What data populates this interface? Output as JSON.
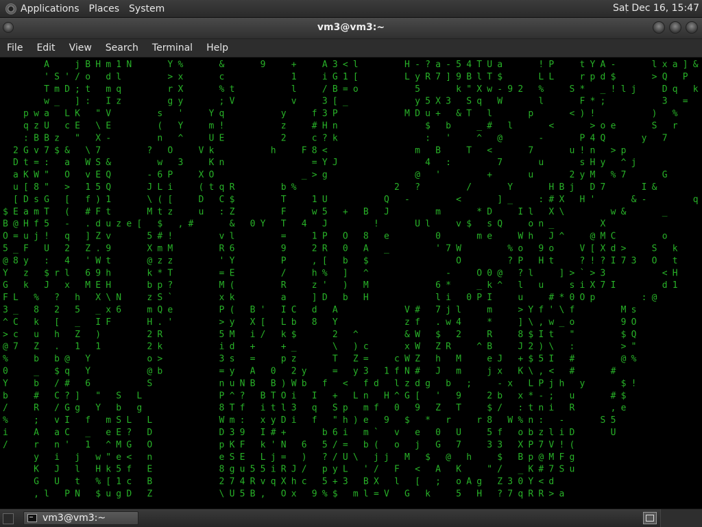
{
  "top_panel": {
    "logo_icon": "gnome-foot-icon",
    "menus": [
      "Applications",
      "Places",
      "System"
    ],
    "clock": "Sat Dec 16, 15:47"
  },
  "window": {
    "title": "vm3@vm3:~"
  },
  "menubar": {
    "items": [
      "File",
      "Edit",
      "View",
      "Search",
      "Terminal",
      "Help"
    ]
  },
  "terminal": {
    "program_colors": {
      "background": "#000000",
      "dim": "#28b228",
      "bright": "#d8d8d8"
    },
    "rain": [
      "    A  jBHm1N   Y%   &   9  +  A3<l    H-?a-54TUa   !P  tYA-   lxa]&    s2",
      "    'S'/o dl    >x   c      1  iG1[    LyR7]9BlT$   LL  rpd$   >Q P D   Yz1",
      "    TmD;t mq    rX   %t     l  /B=o     5   k\"Xw-92 %  S* _!lj  Dq k     .:",
      "    w_ ]: Iz    gy   ;V     v  3[_      y5X3 Sq W   l   F*;     3 = 5   ^w",
      "  pwa LK \"V    s '  Yq     y  f3P      MDu+ &T l   p   <)!     ) %     #4",
      "  qzU cE \\E    ( Y  m!     z  #Hn        $ b  _# l   <   >oe   S r     4W",
      "  :BBz \" X-    n ^  UE     2  c?k        : '  ^ @   -   P4Q   y 7     cV",
      " 2Gv7$& \\7    ? O  Vk     h  F8<        m B  T <   7   u!n >p         Hm",
      " Dt=: a WS&    w 3  Kn        =YJ        4 :    7   u   sHy ^j         C;",
      " aKW\" O vEQ   -6P  XO        _>g        @ '    +   u   2yM %7   G     A;",
      " u[8\" > 15Q   JLi  (tqR    b%         2 ?    /   Y   HBj D7   I&    A/",
      " [DsG [ f)1   \\([  D C$    T  1U     Q -    <   ]_  :#X H'   &-    q1",
      "$EamT ( #Ft   Mtz  u :Z    F  w5 + B J    m   *D  Il X\\    w&   _",
      "B@Hf5 - .duze[ $ ,#   & 0Y T 4 J    !   Ul  v$ sQ  on_    X",
      "O=uj! q ]Zv   5#!    vl    =  1P O 8 e    0   me  Wh J^  @MC    o",
      "5_F U 2 Z.9   XmM    R6    9  2R 0 A _    '7W    %o 9o  V[Xd>  S k",
      "@8y : 4 'Wt   @zz    'Y    P  ,[ b $        O    ?P Ht  ?!?I73 O t",
      "Y z $rl 69h   k*T    =E    /  h% ] ^       -  O0@ ?l  ]>`>3     <H",
      "G k J x MEH   bp?    M(    R  z' ) M      6*  _k^ l u  siX7I    d1",
      "FL % ? h X\\N  zS`    xk    a  ]D b H      li 0PI  u  #*0Op    :@",
      "3_ 8 2 5 _x6  mQe    P( B' IC d A      V# 7jl  m  >Yf'\\f    Ms",
      "^C k [ _ IF   H.'    >y X[ Lb 8 Y      zf .w4  *  ]\\,w_o    9O",
      ">c u h Z )    2R     5M i/ k$   2 ^    &W $ 2  R  8$It \"    $Q",
      "@7 Z . 1 1    2k     id +  +_   \\ )c   xW ZR  ^B  J2)\\ :    >\"",
      "%  b b@ Y     o>     3s =  pz   T Z=  cWZ h M  eJ +$5I #    @%",
      "0  _ $q Y     @b     =y A 0 2y  = y3 1fN# J m  jx K\\,< #   #",
      "Y  b /# 6     S      nuNB B)Wb f < fd lzdg b ;  -x LPjh y   $!",
      "b  # C?] \" S L       P^? BTOi I + Ln H^G[ ' 9  2b x*-; u   #$",
      "/  R /Gg Y b g       8Tf itl3 q Sp mf 0 9 Z T  $/ :tni R   ,e",
      "%  ; vI f mSL L      Wm: xyDi f \"h)e 9 $ * r  r8 W%n: -   S5",
      "i  A aC _ eE? D      D39 I#+   b6i m` v e 0 U  5f obzliD   U",
      "/  r n' 1 ^MG O      pKF k'N 6 5/= b( o j G 7  33 XP7V!(",
      "   y i j w\"e< n      eSE Lj= ) ?/U\\ jj M $ @ h  $ Bp@MFg",
      "   K J l Hk5f E      8gu55iRJ/ pyL '/ F < A K  \"/ _K#7Su",
      "   G U t %[1c B      274RvqXhc 5+3 BX l [ ; oAg Z30Y<d",
      "   ,l PN $ugD Z      \\U5B, Ox 9%$ ml=V G k  5 H ?7qRR>a"
    ]
  }
}
